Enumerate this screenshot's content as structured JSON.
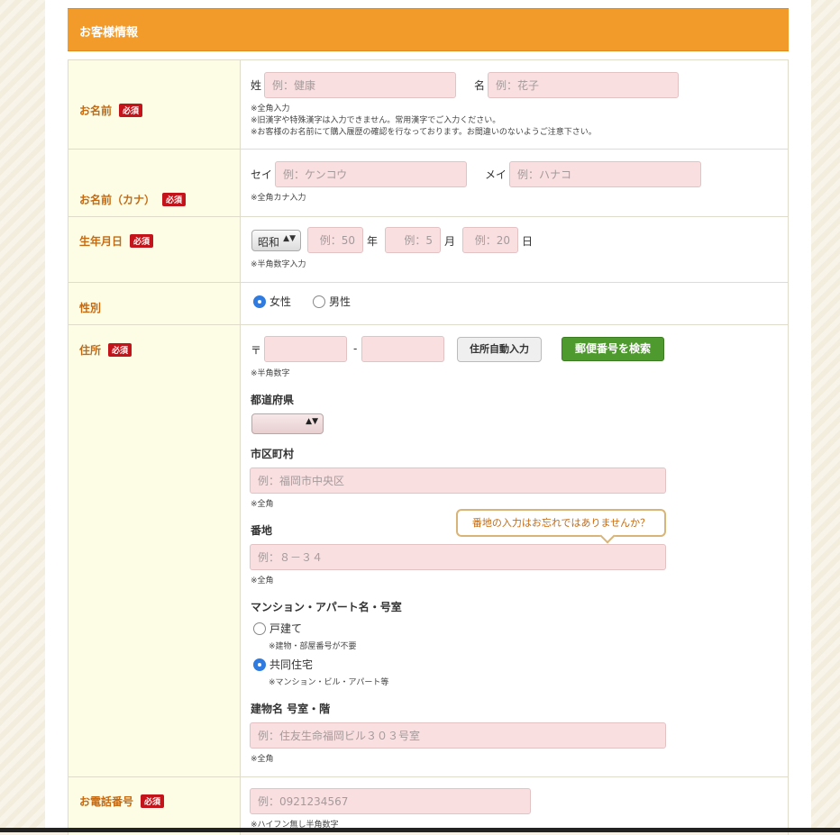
{
  "section_title": "お客様情報",
  "required_badge": "必須",
  "name": {
    "label": "お名前",
    "last_label": "姓",
    "last_placeholder": "例：健康",
    "first_label": "名",
    "first_placeholder": "例：花子",
    "notes": [
      "※全角入力",
      "※旧漢字や特殊漢字は入力できません。常用漢字でご入力ください。",
      "※お客様のお名前にて購入履歴の確認を行なっております。お間違いのないようご注意下さい。"
    ]
  },
  "kana": {
    "label": "お名前（カナ）",
    "last_label": "セイ",
    "last_placeholder": "例：ケンコウ",
    "first_label": "メイ",
    "first_placeholder": "例：ハナコ",
    "note": "※全角カナ入力"
  },
  "birth": {
    "label": "生年月日",
    "era": "昭和",
    "year_placeholder": "例：50",
    "year_unit": "年",
    "month_placeholder": "例：5",
    "month_unit": "月",
    "day_placeholder": "例：20",
    "day_unit": "日",
    "note": "※半角数字入力"
  },
  "gender": {
    "label": "性別",
    "female": "女性",
    "male": "男性"
  },
  "address": {
    "label": "住所",
    "postal_mark": "〒",
    "postal_dash": "-",
    "auto_button": "住所自動入力",
    "search_button": "郵便番号を検索",
    "postal_note": "※半角数字",
    "prefecture_label": "都道府県",
    "city_label": "市区町村",
    "city_placeholder": "例：福岡市中央区",
    "city_note": "※全角",
    "street_label": "番地",
    "street_tooltip": "番地の入力はお忘れではありませんか？",
    "street_placeholder": "例：８－３４",
    "street_note": "※全角",
    "building_section_label": "マンション・アパート名・号室",
    "house_option": "戸建て",
    "house_note": "※建物・部屋番号が不要",
    "apartment_option": "共同住宅",
    "apartment_note": "※マンション・ビル・アパート等",
    "building_label": "建物名 号室・階",
    "building_placeholder": "例：住友生命福岡ビル３０３号室",
    "building_note": "※全角"
  },
  "phone": {
    "label": "お電話番号",
    "placeholder": "例：0921234567",
    "note": "※ハイフン無し半角数字"
  }
}
